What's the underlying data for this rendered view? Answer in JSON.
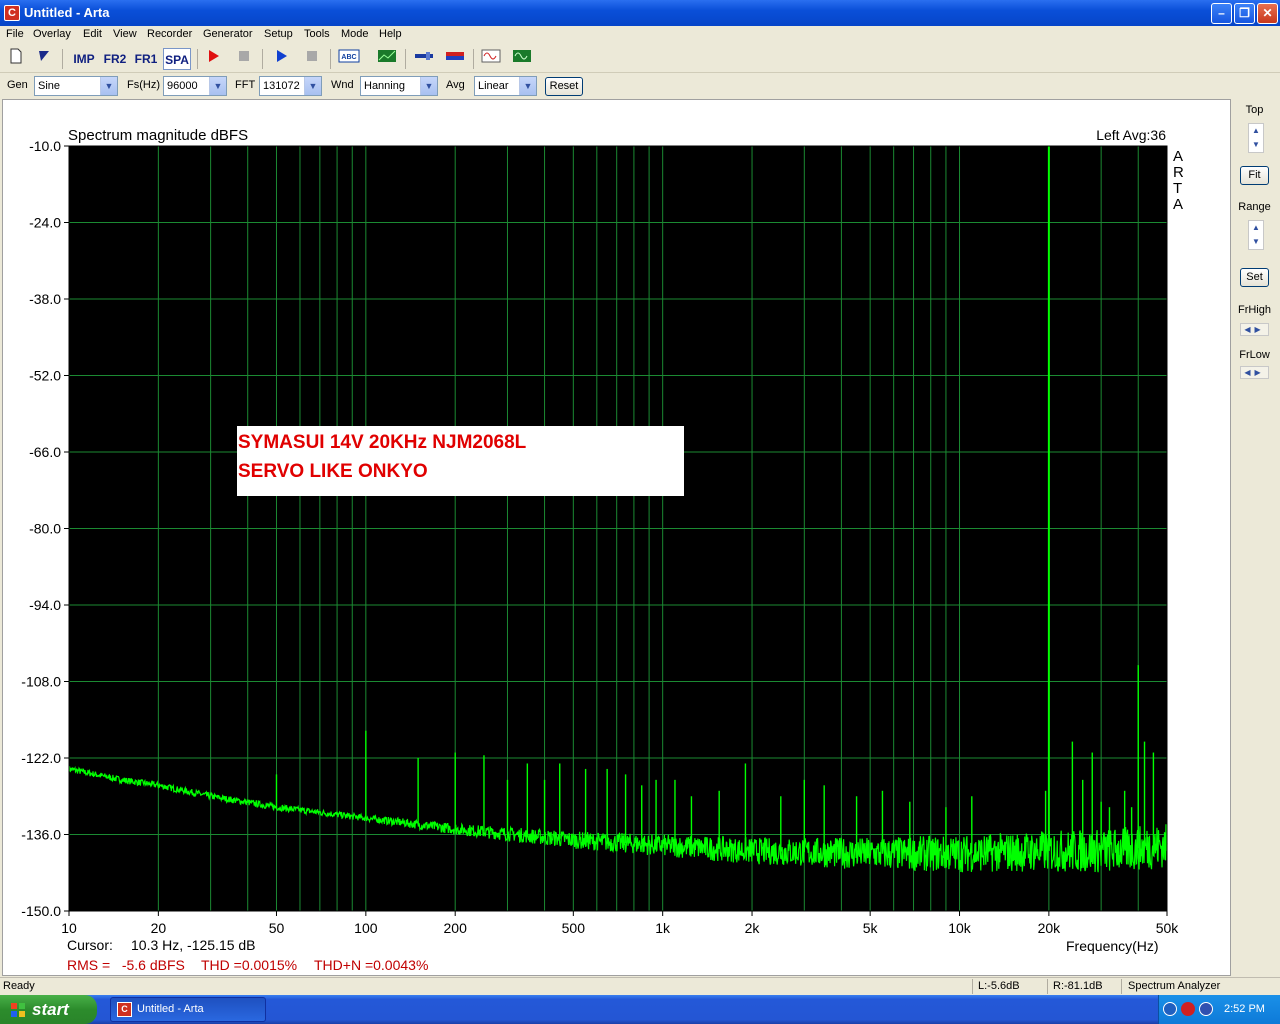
{
  "window": {
    "title": "Untitled - Arta",
    "app_icon_letter": "C"
  },
  "menu": [
    "File",
    "Overlay",
    "Edit",
    "View",
    "Recorder",
    "Generator",
    "Setup",
    "Tools",
    "Mode",
    "Help"
  ],
  "toolbar": {
    "mode_buttons": [
      {
        "label": "IMP",
        "name": "impulse-mode"
      },
      {
        "label": "FR2",
        "name": "fr2-mode"
      },
      {
        "label": "FR1",
        "name": "fr1-mode"
      },
      {
        "label": "SPA",
        "name": "spectrum-mode"
      }
    ]
  },
  "params": {
    "gen_label": "Gen",
    "gen_value": "Sine",
    "fs_label": "Fs(Hz)",
    "fs_value": "96000",
    "fft_label": "FFT",
    "fft_value": "131072",
    "wnd_label": "Wnd",
    "wnd_value": "Hanning",
    "avg_label": "Avg",
    "avg_value": "Linear",
    "reset_label": "Reset"
  },
  "chart_data": {
    "type": "line",
    "title": "Spectrum magnitude dBFS",
    "channel_info": "Left  Avg:36",
    "xlabel": "Frequency(Hz)",
    "x_scale": "log",
    "xlim": [
      10,
      50000
    ],
    "ylim": [
      -150,
      -10
    ],
    "y_ticks": [
      "-10.0",
      "-24.0",
      "-38.0",
      "-52.0",
      "-66.0",
      "-80.0",
      "-94.0",
      "-108.0",
      "-122.0",
      "-136.0",
      "-150.0"
    ],
    "x_ticks": [
      {
        "label": "10",
        "f": 10
      },
      {
        "label": "20",
        "f": 20
      },
      {
        "label": "50",
        "f": 50
      },
      {
        "label": "100",
        "f": 100
      },
      {
        "label": "200",
        "f": 200
      },
      {
        "label": "500",
        "f": 500
      },
      {
        "label": "1k",
        "f": 1000
      },
      {
        "label": "2k",
        "f": 2000
      },
      {
        "label": "5k",
        "f": 5000
      },
      {
        "label": "10k",
        "f": 10000
      },
      {
        "label": "20k",
        "f": 20000
      },
      {
        "label": "50k",
        "f": 50000
      }
    ],
    "watermark": "A R T A",
    "noise_floor": [
      [
        10,
        -124
      ],
      [
        15,
        -126
      ],
      [
        20,
        -127
      ],
      [
        30,
        -129
      ],
      [
        50,
        -131
      ],
      [
        100,
        -133
      ],
      [
        200,
        -135
      ],
      [
        500,
        -137
      ],
      [
        1000,
        -138
      ],
      [
        2000,
        -139
      ],
      [
        5000,
        -139.5
      ],
      [
        10000,
        -139.5
      ],
      [
        20000,
        -139
      ],
      [
        30000,
        -139
      ],
      [
        40000,
        -138.5
      ],
      [
        50000,
        -138
      ]
    ],
    "peaks": [
      {
        "f": 20000,
        "db": -10
      },
      {
        "f": 40000,
        "db": -105
      },
      {
        "f": 100,
        "db": -117
      },
      {
        "f": 50,
        "db": -125
      },
      {
        "f": 150,
        "db": -122
      },
      {
        "f": 200,
        "db": -121
      },
      {
        "f": 250,
        "db": -121.5
      },
      {
        "f": 300,
        "db": -126
      },
      {
        "f": 350,
        "db": -123
      },
      {
        "f": 400,
        "db": -126
      },
      {
        "f": 450,
        "db": -123
      },
      {
        "f": 550,
        "db": -124
      },
      {
        "f": 650,
        "db": -124
      },
      {
        "f": 750,
        "db": -125
      },
      {
        "f": 850,
        "db": -127
      },
      {
        "f": 950,
        "db": -126
      },
      {
        "f": 1100,
        "db": -126
      },
      {
        "f": 1250,
        "db": -129
      },
      {
        "f": 1550,
        "db": -128
      },
      {
        "f": 1900,
        "db": -123
      },
      {
        "f": 2500,
        "db": -129
      },
      {
        "f": 3000,
        "db": -126
      },
      {
        "f": 3500,
        "db": -127
      },
      {
        "f": 4500,
        "db": -129
      },
      {
        "f": 5500,
        "db": -128
      },
      {
        "f": 6800,
        "db": -130
      },
      {
        "f": 9000,
        "db": -131
      },
      {
        "f": 11000,
        "db": -129
      },
      {
        "f": 19500,
        "db": -128
      },
      {
        "f": 24000,
        "db": -119
      },
      {
        "f": 26000,
        "db": -126
      },
      {
        "f": 28000,
        "db": -121
      },
      {
        "f": 30000,
        "db": -130
      },
      {
        "f": 32000,
        "db": -131
      },
      {
        "f": 36000,
        "db": -128
      },
      {
        "f": 38000,
        "db": -131
      },
      {
        "f": 42000,
        "db": -119
      },
      {
        "f": 45000,
        "db": -121
      }
    ],
    "annotation": [
      "SYMASUI 14V 20KHz NJM2068L",
      "SERVO LIKE ONKYO"
    ],
    "trace_color": "#00ff00",
    "grid_color": "#1b8a32",
    "background": "#000000"
  },
  "readouts": {
    "cursor_label": "Cursor:",
    "cursor_value": "10.3 Hz, -125.15 dB",
    "rms": "RMS =   -5.6 dBFS",
    "thd": "THD =0.0015%",
    "thdn": "THD+N =0.0043%"
  },
  "right_panel": {
    "top_label": "Top",
    "fit_label": "Fit",
    "range_label": "Range",
    "set_label": "Set",
    "frhigh_label": "FrHigh",
    "frlow_label": "FrLow"
  },
  "status": {
    "ready": "Ready",
    "left_level": "L:-5.6dB",
    "right_level": "R:-81.1dB",
    "mode": "Spectrum Analyzer"
  },
  "taskbar": {
    "start_label": "start",
    "task_item": "Untitled - Arta",
    "clock": "2:52 PM"
  }
}
